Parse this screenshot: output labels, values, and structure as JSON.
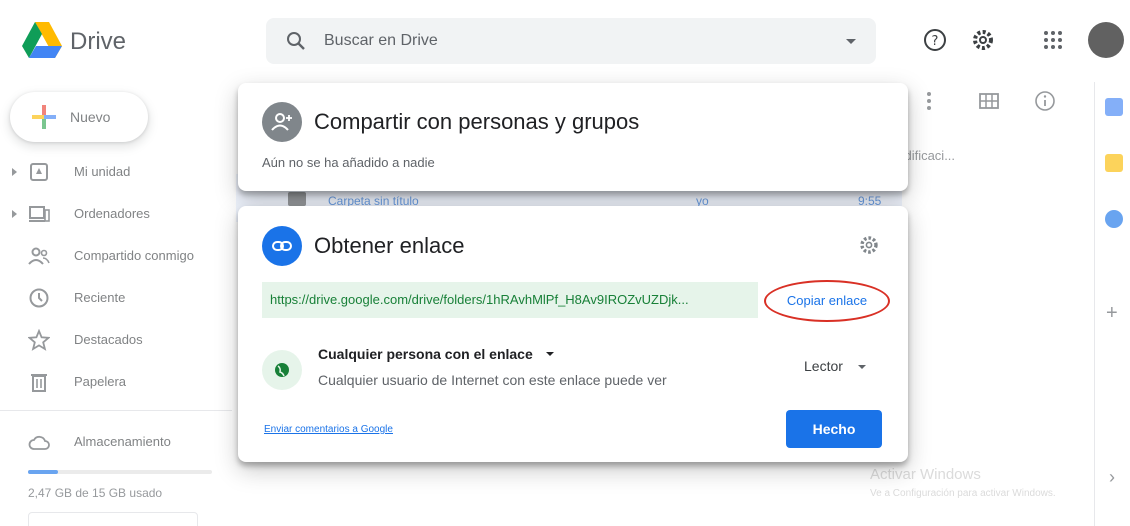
{
  "app": {
    "name": "Drive"
  },
  "search": {
    "placeholder": "Buscar en Drive"
  },
  "sidebar": {
    "new_label": "Nuevo",
    "items": [
      {
        "label": "Mi unidad"
      },
      {
        "label": "Ordenadores"
      },
      {
        "label": "Compartido conmigo"
      },
      {
        "label": "Reciente"
      },
      {
        "label": "Destacados"
      },
      {
        "label": "Papelera"
      },
      {
        "label": "Almacenamiento"
      }
    ],
    "storage_text": "2,47 GB de 15 GB usado",
    "storage_used_fraction": 0.165
  },
  "background": {
    "column_header": "nodificaci...",
    "row": {
      "name": "Carpeta sin título",
      "owner": "yo",
      "time": "9:55"
    },
    "watermark_title": "Activar Windows",
    "watermark_sub": "Ve a Configuración para activar Windows."
  },
  "share_dialog": {
    "title": "Compartir con personas y grupos",
    "subtitle": "Aún no se ha añadido a nadie"
  },
  "link_dialog": {
    "title": "Obtener enlace",
    "link": "https://drive.google.com/drive/folders/1hRAvhMlPf_H8Av9IROZvUZDjk...",
    "copy_label": "Copiar enlace",
    "access_title": "Cualquier persona con el enlace",
    "access_desc": "Cualquier usuario de Internet con este enlace puede ver",
    "role": "Lector",
    "feedback": "Enviar comentarios a Google",
    "done_label": "Hecho"
  },
  "colors": {
    "accent": "#1a73e8",
    "link_bg": "#e6f4ea",
    "link_text": "#188038",
    "highlight_ring": "#d93025"
  }
}
